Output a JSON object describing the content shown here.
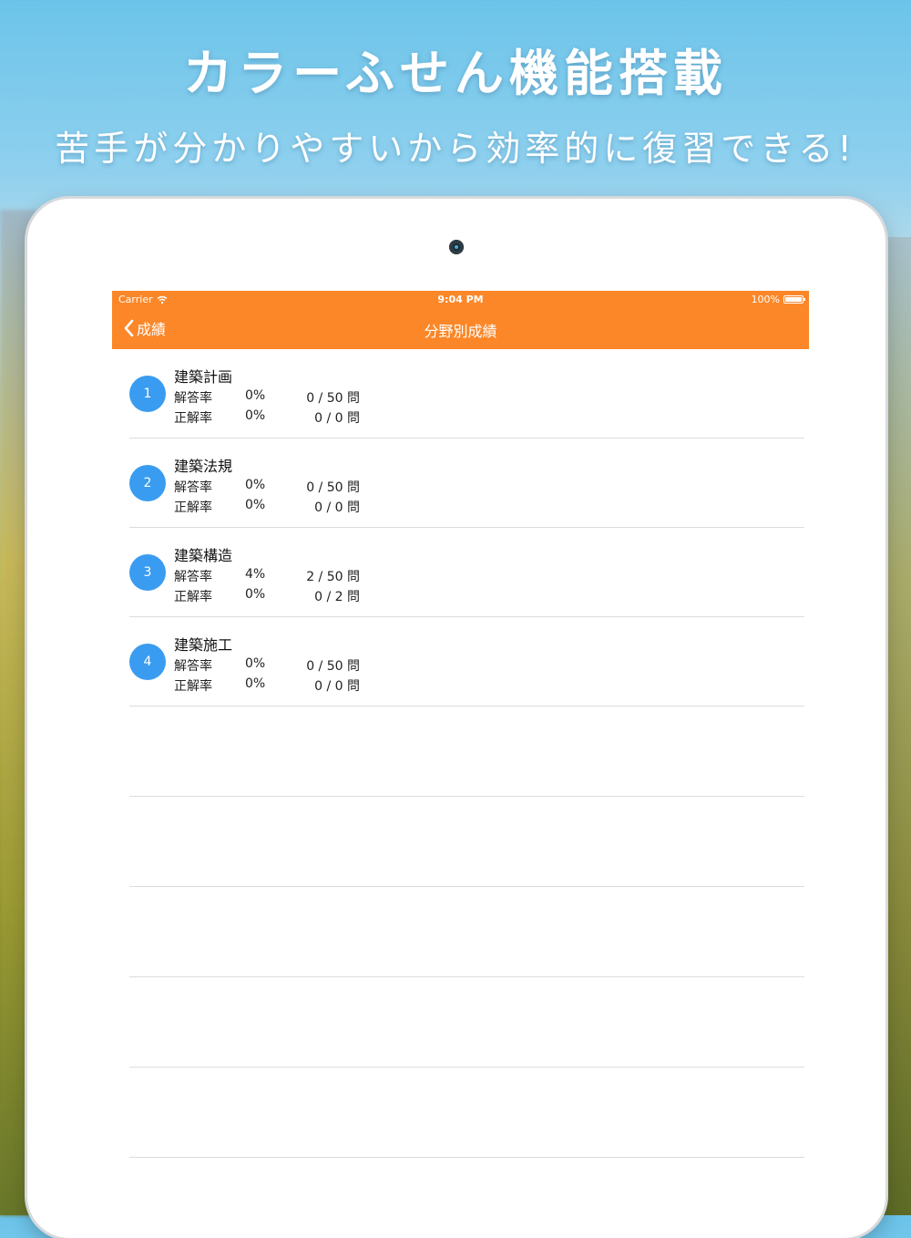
{
  "banner": {
    "headline": "カラーふせん機能搭載",
    "subline": "苦手が分かりやすいから効率的に復習できる!"
  },
  "status_bar": {
    "carrier": "Carrier",
    "time": "9:04 PM",
    "battery": "100%"
  },
  "nav": {
    "back_label": "成績",
    "title": "分野別成績"
  },
  "colors": {
    "nav_orange": "#fb8728",
    "badge_blue": "#3a9cf0"
  },
  "categories": [
    {
      "num": "1",
      "name": "建築計画",
      "answer_label": "解答率",
      "answer_pct": "0%",
      "answer_count": "0 / 50 問",
      "correct_label": "正解率",
      "correct_pct": "0%",
      "correct_count": "0 / 0 問"
    },
    {
      "num": "2",
      "name": "建築法規",
      "answer_label": "解答率",
      "answer_pct": "0%",
      "answer_count": "0 / 50 問",
      "correct_label": "正解率",
      "correct_pct": "0%",
      "correct_count": "0 / 0 問"
    },
    {
      "num": "3",
      "name": "建築構造",
      "answer_label": "解答率",
      "answer_pct": "4%",
      "answer_count": "2 / 50 問",
      "correct_label": "正解率",
      "correct_pct": "0%",
      "correct_count": "0 / 2 問"
    },
    {
      "num": "4",
      "name": "建築施工",
      "answer_label": "解答率",
      "answer_pct": "0%",
      "answer_count": "0 / 50 問",
      "correct_label": "正解率",
      "correct_pct": "0%",
      "correct_count": "0 / 0 問"
    }
  ]
}
